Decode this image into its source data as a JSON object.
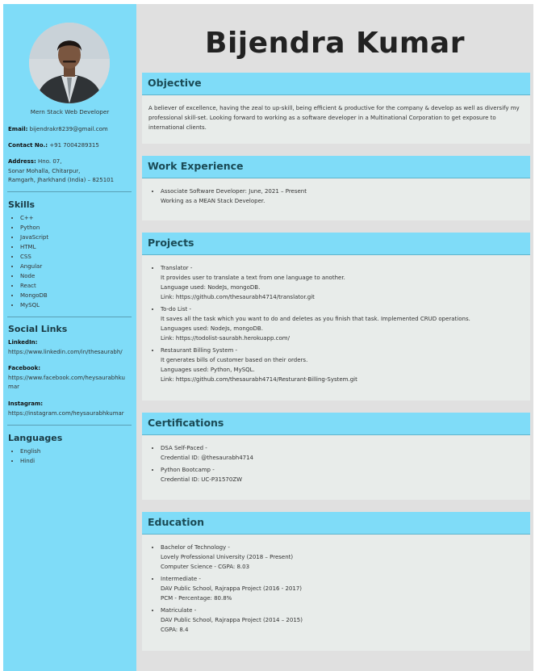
{
  "sidebar": {
    "role": "Mern Stack Web Developer",
    "email_label": "Email:",
    "email": "bijendrakr8239@gmail.com",
    "contact_label": "Contact No.:",
    "contact": "+91 7004289315",
    "address_label": "Address:",
    "address_line1": "Hno. 07,",
    "address_line2": "Sonar Mohalla, Chitarpur,",
    "address_line3": "Ramgarh, Jharkhand (India) – 825101",
    "skills_title": "Skills",
    "skills": [
      "C++",
      "Python",
      "JavaScript",
      "HTML",
      "CSS",
      "Angular",
      "Node",
      "React",
      "MongoDB",
      "MySQL"
    ],
    "social_title": "Social Links",
    "linkedin_label": "LinkedIn:",
    "linkedin": "https://www.linkedin.com/in/thesaurabh/",
    "facebook_label": "Facebook:",
    "facebook_line1": "https://www.facebook.com/heysaurabhku",
    "facebook_line2": "mar",
    "instagram_label": "Instagram:",
    "instagram": "https://instagram.com/heysaurabhkumar",
    "languages_title": "Languages",
    "languages": [
      "English",
      "Hindi"
    ]
  },
  "main": {
    "name": "Bijendra Kumar",
    "objective": {
      "title": "Objective",
      "text": "A believer of excellence, having the zeal to up-skill, being efficient & productive for the company & develop as well as diversify my professional skill-set. Looking forward to working as a software developer in a Multinational Corporation to get exposure to international clients."
    },
    "work": {
      "title": "Work Experience",
      "items": [
        {
          "l1": "Associate Software Developer: June, 2021 – Present",
          "l2": "Working as a MEAN Stack Developer."
        }
      ]
    },
    "projects": {
      "title": "Projects",
      "items": [
        {
          "l1": "Translator -",
          "l2": "It provides user to translate a text from one language to another.",
          "l3": "Language used: NodeJs, mongoDB.",
          "l4": "Link: https://github.com/thesaurabh4714/translator.git"
        },
        {
          "l1": "To-do List -",
          "l2": "It saves all the task which you want to do and deletes as you finish that task. Implemented CRUD operations.",
          "l3": "Languages used: NodeJs, mongoDB.",
          "l4": "Link: https://todolist-saurabh.herokuapp.com/"
        },
        {
          "l1": "Restaurant Billing System -",
          "l2": "It generates bills of customer based on their orders.",
          "l3": "Languages used: Python, MySQL.",
          "l4": "Link: https://github.com/thesaurabh4714/Resturant-Billing-System.git"
        }
      ]
    },
    "certifications": {
      "title": "Certifications",
      "items": [
        {
          "l1": "DSA Self-Paced -",
          "l2": "Credential ID: @thesaurabh4714"
        },
        {
          "l1": "Python Bootcamp -",
          "l2": "Credential ID: UC-P31570ZW"
        }
      ]
    },
    "education": {
      "title": "Education",
      "items": [
        {
          "l1": "Bachelor of Technology -",
          "l2": "Lovely Professional University (2018 – Present)",
          "l3": "Computer Science - CGPA: 8.03"
        },
        {
          "l1": "Intermediate -",
          "l2": "DAV Public School, Rajrappa Project (2016 - 2017)",
          "l3": "PCM - Percentage: 80.8%"
        },
        {
          "l1": "Matriculate -",
          "l2": "DAV Public School, Rajrappa Project (2014 – 2015)",
          "l3": "CGPA: 8.4"
        }
      ]
    }
  }
}
